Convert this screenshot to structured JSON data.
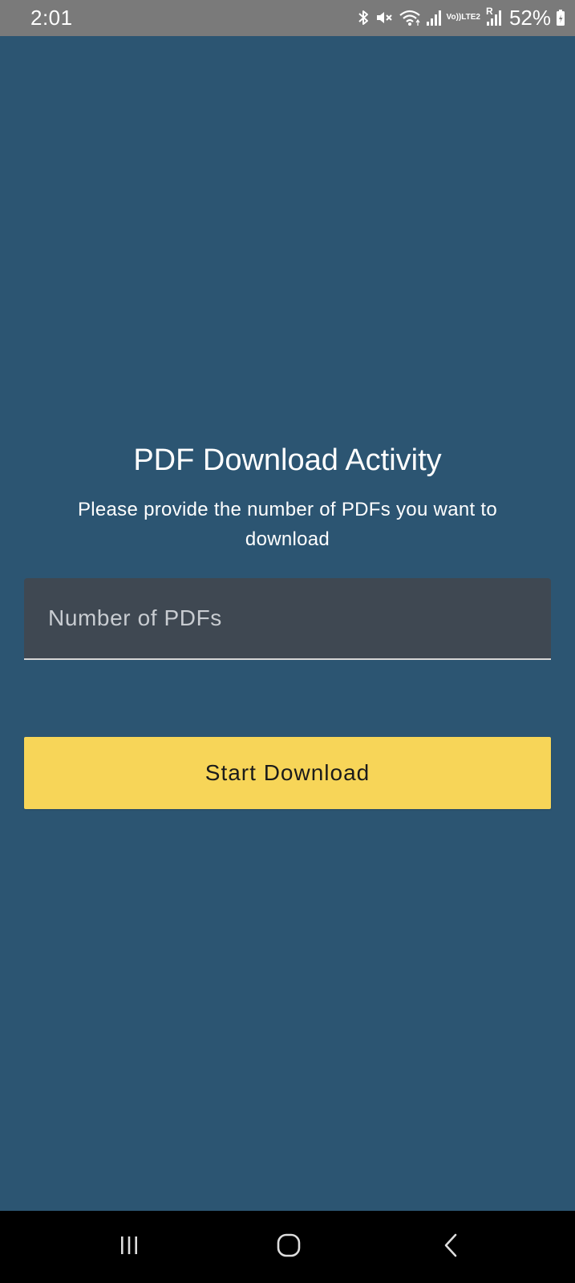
{
  "status_bar": {
    "time": "2:01",
    "volte_top": "Vo))",
    "volte_bottom": "LTE2",
    "roaming": "R",
    "battery": "52%",
    "icons": [
      "bluetooth-icon",
      "mute-icon",
      "wifi-icon",
      "signal-icon",
      "volte-icon",
      "roaming-signal-icon",
      "battery-icon"
    ]
  },
  "app": {
    "title": "PDF Download Activity",
    "subtitle": "Please provide the number of PDFs you want to download",
    "input": {
      "placeholder": "Number of PDFs",
      "value": ""
    },
    "start_button_label": "Start Download"
  },
  "nav_bar": {
    "icons": [
      "recent-apps-icon",
      "home-icon",
      "back-icon"
    ]
  },
  "colors": {
    "background": "#2c5572",
    "status_bar": "#7a7a7a",
    "input_background": "#3f4852",
    "button": "#f7d558",
    "nav_bar": "#000000"
  }
}
